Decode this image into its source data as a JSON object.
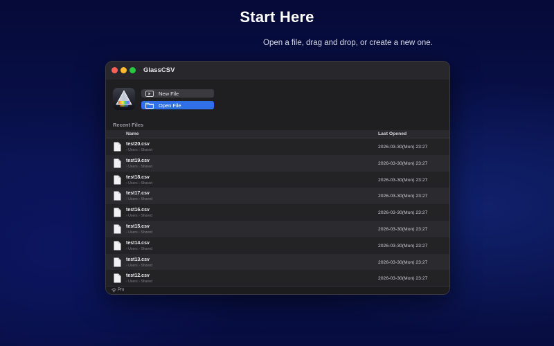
{
  "hero": {
    "title": "Start Here",
    "subtitle": "Open a file, drag and drop, or create a new one."
  },
  "window": {
    "title": "GlassCSV"
  },
  "actions": {
    "new_file_label": "New File",
    "open_file_label": "Open File"
  },
  "recent": {
    "section_label": "Recent Files",
    "columns": {
      "name": "Name",
      "last_opened": "Last Opened"
    },
    "files": [
      {
        "name": "test20.csv",
        "path": "› Users › Shared",
        "last_opened": "2026-03-30(Mon) 23:27"
      },
      {
        "name": "test19.csv",
        "path": "› Users › Shared",
        "last_opened": "2026-03-30(Mon) 23:27"
      },
      {
        "name": "test18.csv",
        "path": "› Users › Shared",
        "last_opened": "2026-03-30(Mon) 23:27"
      },
      {
        "name": "test17.csv",
        "path": "› Users › Shared",
        "last_opened": "2026-03-30(Mon) 23:27"
      },
      {
        "name": "test16.csv",
        "path": "› Users › Shared",
        "last_opened": "2026-03-30(Mon) 23:27"
      },
      {
        "name": "test15.csv",
        "path": "› Users › Shared",
        "last_opened": "2026-03-30(Mon) 23:27"
      },
      {
        "name": "test14.csv",
        "path": "› Users › Shared",
        "last_opened": "2026-03-30(Mon) 23:27"
      },
      {
        "name": "test13.csv",
        "path": "› Users › Shared",
        "last_opened": "2026-03-30(Mon) 23:27"
      },
      {
        "name": "test12.csv",
        "path": "› Users › Shared",
        "last_opened": "2026-03-30(Mon) 23:27"
      }
    ]
  },
  "status": {
    "label": "Pro"
  },
  "colors": {
    "accent": "#2f6fe8",
    "background": "#0a1350",
    "window": "#1f1f22"
  },
  "icons": {
    "app": "glass-prism-icon",
    "new_file": "new-file-icon",
    "open_file": "folder-icon",
    "file": "document-icon",
    "status": "wifi-icon"
  }
}
